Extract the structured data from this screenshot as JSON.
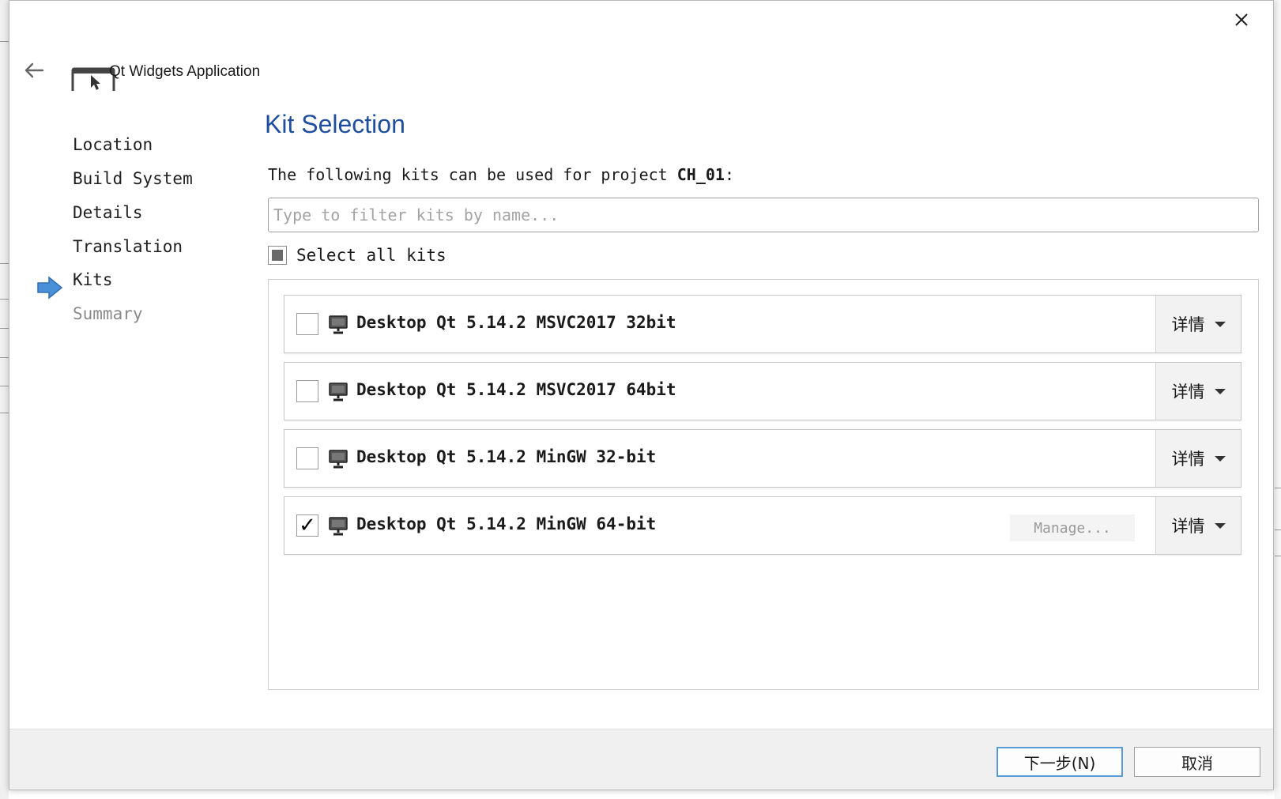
{
  "header": {
    "app_title": "Qt Widgets Application"
  },
  "steps": [
    {
      "label": "Location"
    },
    {
      "label": "Build System"
    },
    {
      "label": "Details"
    },
    {
      "label": "Translation"
    },
    {
      "label": "Kits"
    },
    {
      "label": "Summary"
    }
  ],
  "current_step": "Kits",
  "page": {
    "title": "Kit Selection",
    "intro_prefix": "The following kits can be used for project ",
    "project_name": "CH_01",
    "intro_suffix": ":"
  },
  "filter": {
    "placeholder": "Type to filter kits by name...",
    "value": ""
  },
  "select_all": {
    "label": "Select all kits",
    "state": "partial"
  },
  "kits": [
    {
      "name": "Desktop Qt 5.14.2 MSVC2017 32bit",
      "checked": false,
      "details_label": "详情",
      "manage_label": ""
    },
    {
      "name": "Desktop Qt 5.14.2 MSVC2017 64bit",
      "checked": false,
      "details_label": "详情",
      "manage_label": ""
    },
    {
      "name": "Desktop Qt 5.14.2 MinGW 32-bit",
      "checked": false,
      "details_label": "详情",
      "manage_label": ""
    },
    {
      "name": "Desktop Qt 5.14.2 MinGW 64-bit",
      "checked": true,
      "check_glyph": "✓",
      "details_label": "详情",
      "manage_label": "Manage..."
    }
  ],
  "footer": {
    "next_label": "下一步(N)",
    "cancel_label": "取消"
  },
  "colors": {
    "title_blue": "#1f4e9e",
    "step_arrow_blue": "#4a90d9",
    "next_button_border": "#5a9bd5"
  }
}
